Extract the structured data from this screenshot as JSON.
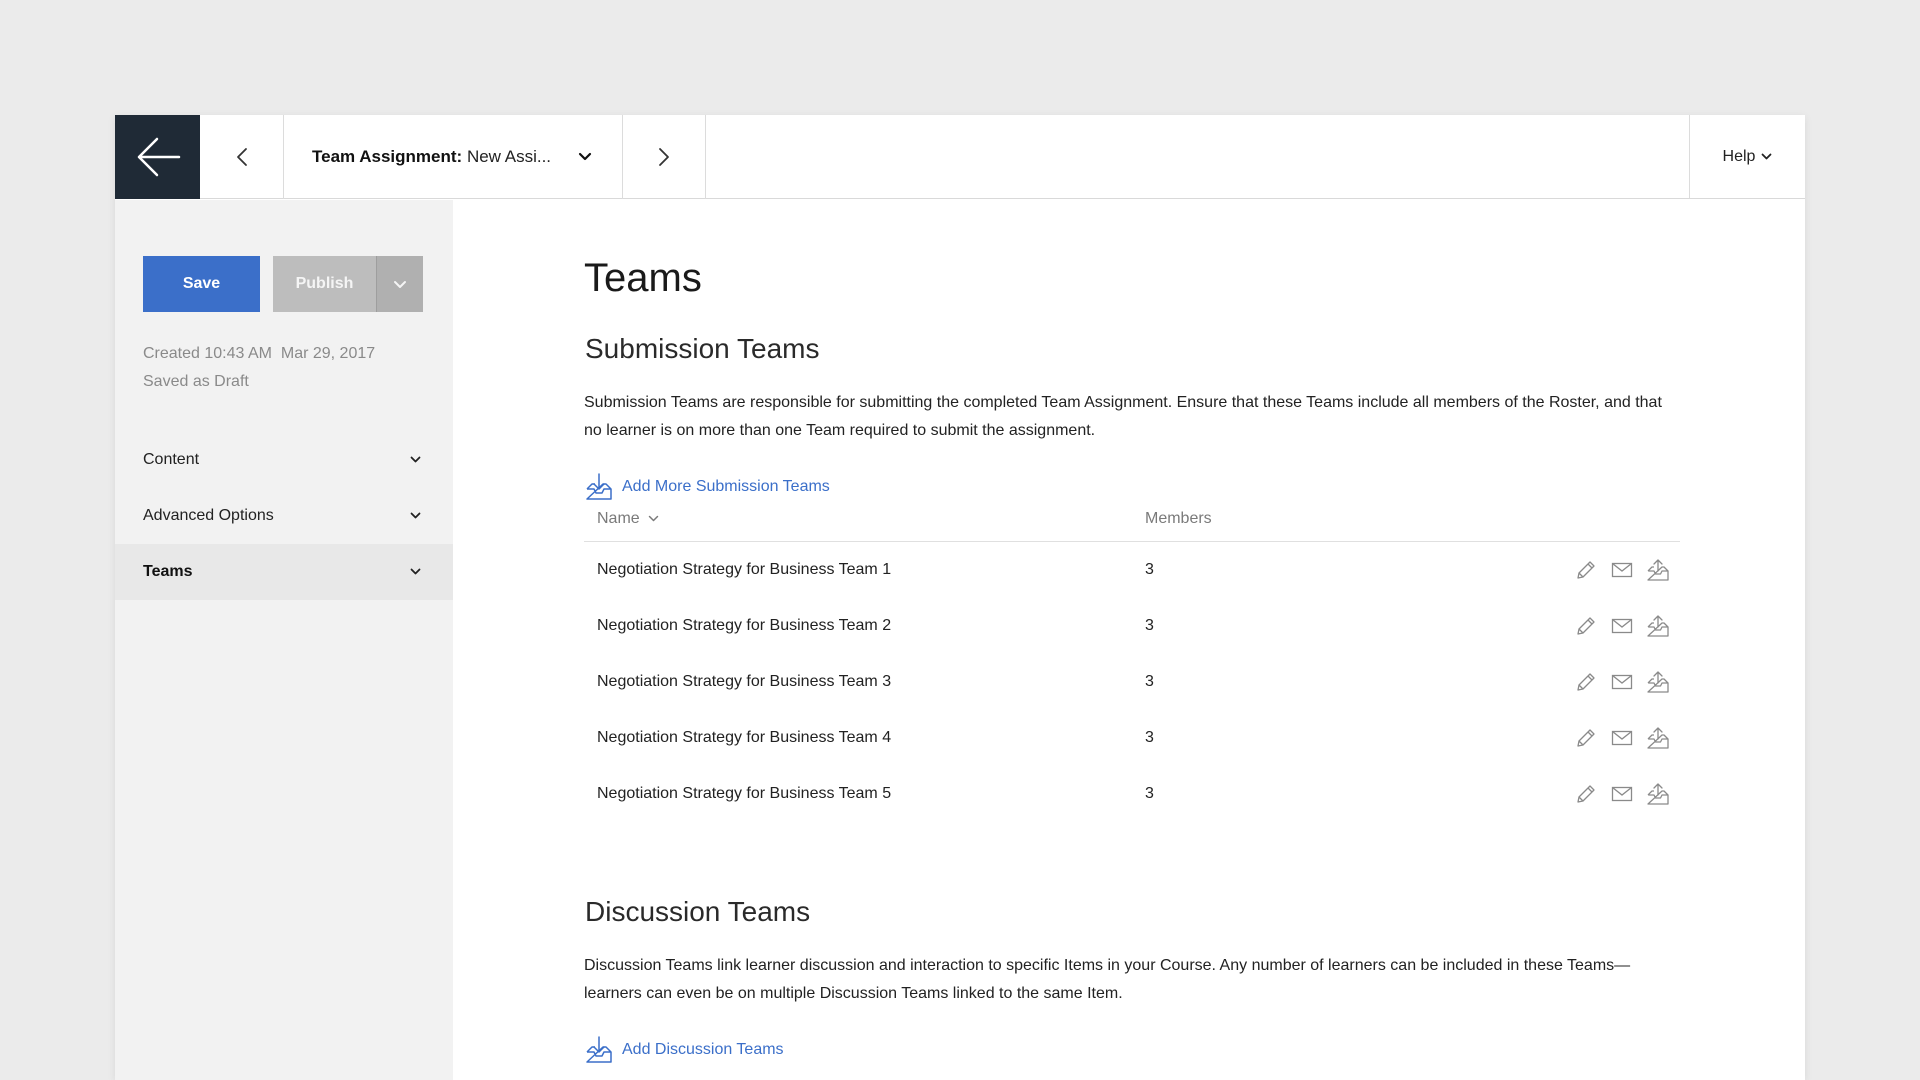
{
  "topbar": {
    "title_label": "Team Assignment:",
    "title_value": "New Assi...",
    "help_label": "Help"
  },
  "sidebar": {
    "save_label": "Save",
    "publish_label": "Publish",
    "created": "Created 10:43 AM  Mar 29, 2017",
    "status": "Saved as Draft",
    "items": [
      {
        "label": "Content"
      },
      {
        "label": "Advanced Options"
      },
      {
        "label": "Teams"
      }
    ]
  },
  "main": {
    "title": "Teams",
    "submission": {
      "title": "Submission Teams",
      "description": "Submission Teams are responsible for submitting the completed Team Assignment. Ensure that these Teams include all members of the Roster, and that no learner is on more than one Team required to submit the assignment.",
      "add_label": "Add More Submission Teams",
      "columns": {
        "name": "Name",
        "members": "Members"
      },
      "rows": [
        {
          "name": "Negotiation Strategy for Business Team 1",
          "members": "3"
        },
        {
          "name": "Negotiation Strategy for Business Team 2",
          "members": "3"
        },
        {
          "name": "Negotiation Strategy for Business Team 3",
          "members": "3"
        },
        {
          "name": "Negotiation Strategy for Business Team 4",
          "members": "3"
        },
        {
          "name": "Negotiation Strategy for Business Team 5",
          "members": "3"
        }
      ]
    },
    "discussion": {
      "title": "Discussion Teams",
      "description": "Discussion Teams link learner discussion and interaction to specific Items in your Course. Any number of learners can be included in these Teams—learners can even be on multiple Discussion Teams linked to the same Item.",
      "add_label": "Add Discussion Teams"
    }
  },
  "icons": {
    "back": "arrow-left-icon",
    "prev": "chevron-left-icon",
    "next": "chevron-right-icon",
    "dropdown": "chevron-down-icon",
    "add": "inbox-download-icon",
    "edit": "pencil-icon",
    "email": "envelope-icon",
    "export": "inbox-upload-icon"
  },
  "colors": {
    "accent": "#3b6fc9",
    "back_bg": "#1f2a36",
    "sidebar_bg": "#f2f2f2",
    "publish_disabled": "#bdbdbd"
  }
}
